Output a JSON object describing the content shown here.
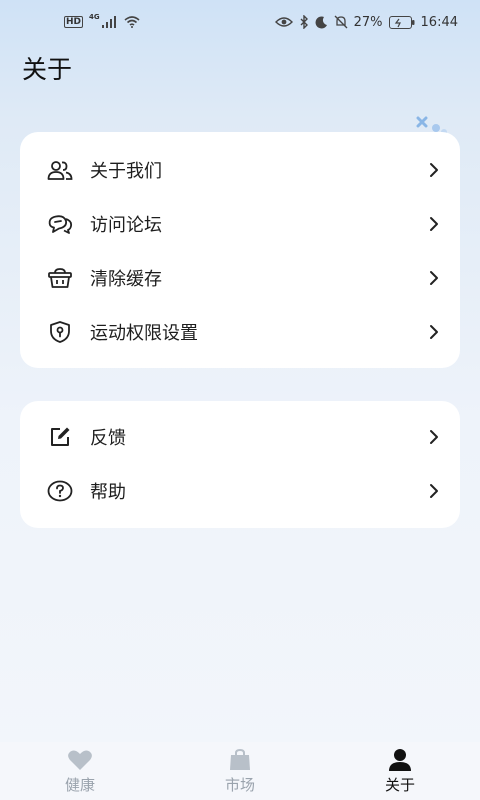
{
  "status_bar": {
    "hd": "HD",
    "network": "4G",
    "battery_percent": "27%",
    "time": "16:44"
  },
  "page": {
    "title": "关于"
  },
  "groups": [
    {
      "items": [
        {
          "label": "关于我们",
          "icon": "people-icon"
        },
        {
          "label": "访问论坛",
          "icon": "chat-bubbles-icon"
        },
        {
          "label": "清除缓存",
          "icon": "basket-icon"
        },
        {
          "label": "运动权限设置",
          "icon": "shield-lock-icon"
        }
      ]
    },
    {
      "items": [
        {
          "label": "反馈",
          "icon": "edit-icon"
        },
        {
          "label": "帮助",
          "icon": "help-circle-icon"
        }
      ]
    }
  ],
  "tab_bar": {
    "tabs": [
      {
        "label": "健康",
        "icon": "heart-icon",
        "active": false
      },
      {
        "label": "市场",
        "icon": "bag-icon",
        "active": false
      },
      {
        "label": "关于",
        "icon": "person-icon",
        "active": true
      }
    ]
  },
  "colors": {
    "accent": "#111111",
    "inactive_tab": "#9aa3ad",
    "card_bg": "#ffffff"
  }
}
